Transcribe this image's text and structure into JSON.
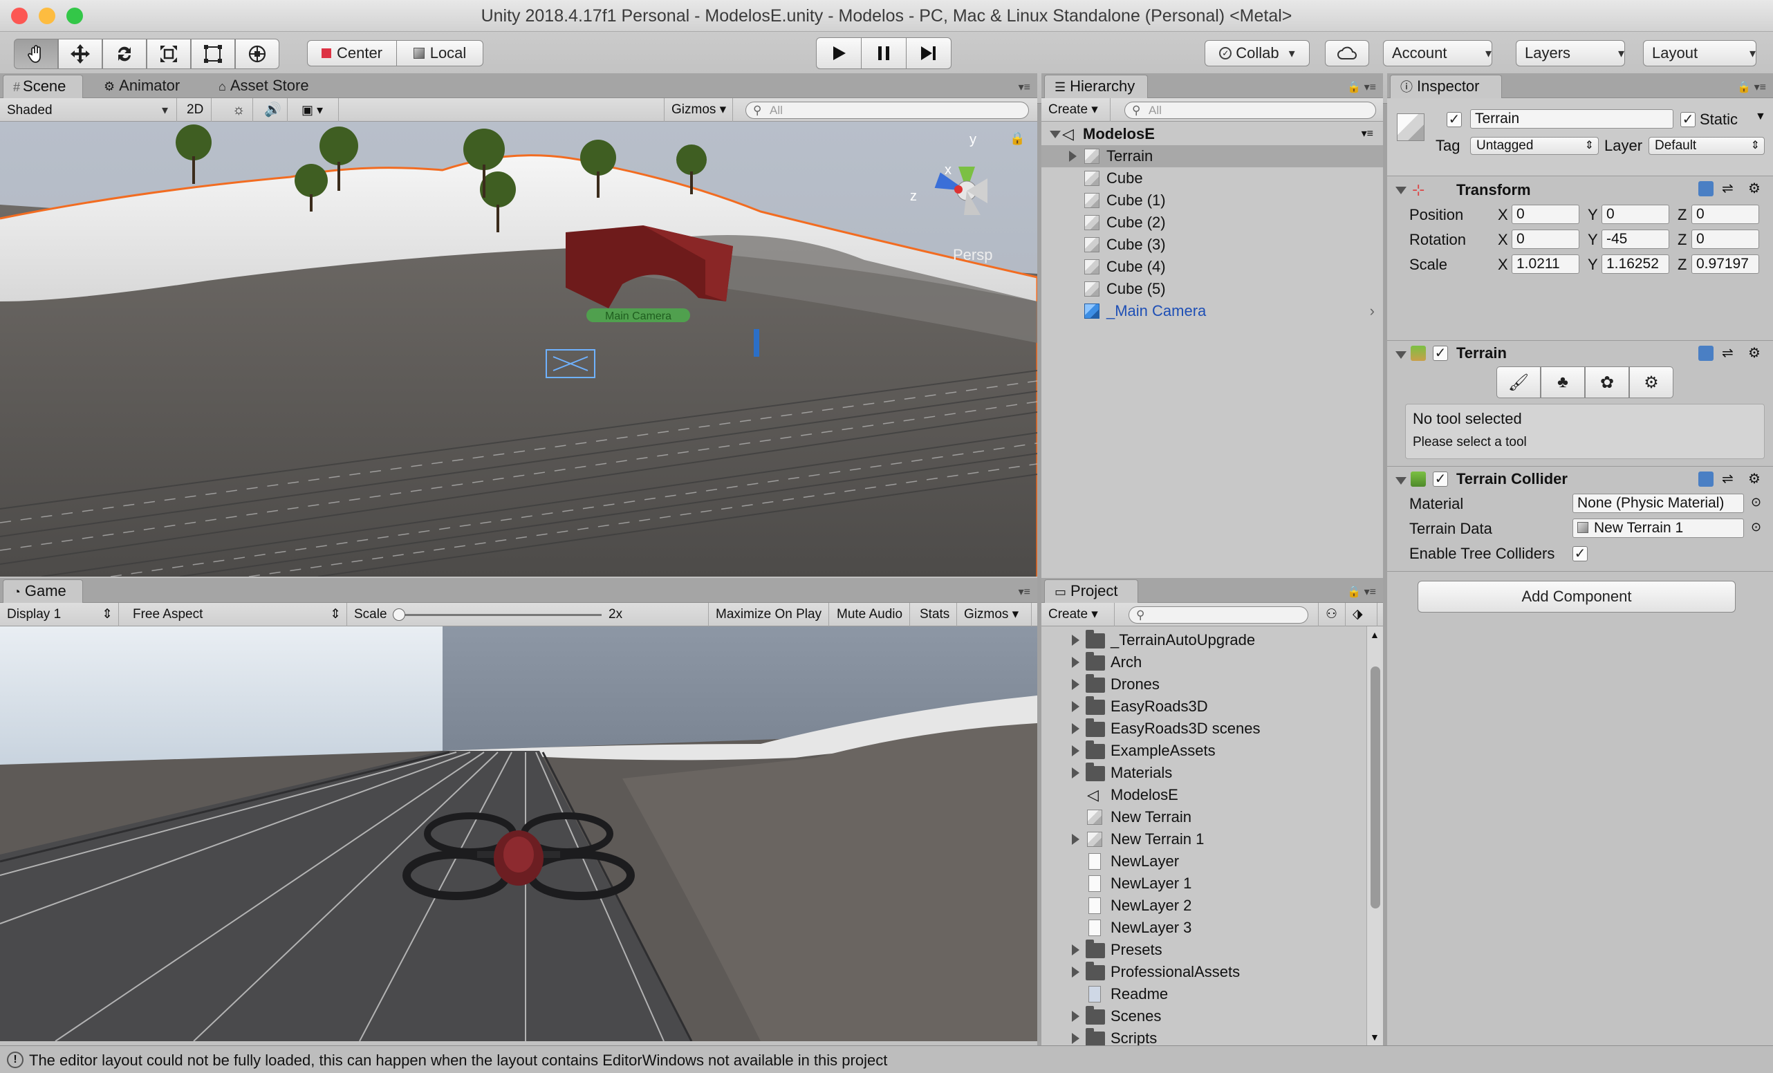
{
  "window": {
    "title": "Unity 2018.4.17f1 Personal - ModelosE.unity - Modelos - PC, Mac & Linux Standalone (Personal) <Metal>"
  },
  "colors": {
    "close": "#fc5753",
    "minimize": "#fdbc40",
    "maximize": "#33c748",
    "selection_orange": "#f26c21",
    "link_blue": "#1e4fb5"
  },
  "toolbar": {
    "tools": [
      "hand-tool",
      "move-tool",
      "rotate-tool",
      "scale-tool",
      "rect-tool",
      "transform-tool"
    ],
    "pivot_center": "Center",
    "pivot_local": "Local",
    "play_controls": [
      "play",
      "pause",
      "step"
    ],
    "collab": "Collab",
    "account": "Account",
    "layers": "Layers",
    "layout": "Layout"
  },
  "scene": {
    "tabs": [
      "Scene",
      "Animator",
      "Asset Store"
    ],
    "shading_mode": "Shaded",
    "mode_2d": "2D",
    "gizmos": "Gizmos",
    "search_placeholder": "All",
    "persp_label": "Persp",
    "camera_label": "Main Camera",
    "axes": {
      "y": "y",
      "x": "x",
      "z": "z"
    }
  },
  "game": {
    "tab": "Game",
    "display": "Display 1",
    "aspect": "Free Aspect",
    "scale_label": "Scale",
    "scale_value": "2x",
    "scale_fraction": 0.0,
    "maximize": "Maximize On Play",
    "mute": "Mute Audio",
    "stats": "Stats",
    "gizmos": "Gizmos"
  },
  "hierarchy": {
    "tab": "Hierarchy",
    "create": "Create",
    "search_placeholder": "All",
    "scene_name": "ModelosE",
    "items": [
      {
        "label": "Terrain",
        "selected": true,
        "has_children": true
      },
      {
        "label": "Cube"
      },
      {
        "label": "Cube (1)"
      },
      {
        "label": "Cube (2)"
      },
      {
        "label": "Cube (3)"
      },
      {
        "label": "Cube (4)"
      },
      {
        "label": "Cube (5)"
      },
      {
        "label": "_Main Camera",
        "prefab": true
      }
    ]
  },
  "project": {
    "tab": "Project",
    "create": "Create",
    "items": [
      {
        "label": "_TerrainAutoUpgrade",
        "type": "folder",
        "expandable": true
      },
      {
        "label": "Arch",
        "type": "folder",
        "expandable": true
      },
      {
        "label": "Drones",
        "type": "folder",
        "expandable": true
      },
      {
        "label": "EasyRoads3D",
        "type": "folder",
        "expandable": true
      },
      {
        "label": "EasyRoads3D scenes",
        "type": "folder",
        "expandable": true
      },
      {
        "label": "ExampleAssets",
        "type": "folder",
        "expandable": true
      },
      {
        "label": "Materials",
        "type": "folder",
        "expandable": true
      },
      {
        "label": "ModelosE",
        "type": "scene",
        "expandable": false
      },
      {
        "label": "New Terrain",
        "type": "terrain",
        "expandable": false
      },
      {
        "label": "New Terrain 1",
        "type": "terrain",
        "expandable": true
      },
      {
        "label": "NewLayer",
        "type": "file",
        "expandable": false
      },
      {
        "label": "NewLayer 1",
        "type": "file",
        "expandable": false
      },
      {
        "label": "NewLayer 2",
        "type": "file",
        "expandable": false
      },
      {
        "label": "NewLayer 3",
        "type": "file",
        "expandable": false
      },
      {
        "label": "Presets",
        "type": "folder",
        "expandable": true
      },
      {
        "label": "ProfessionalAssets",
        "type": "folder",
        "expandable": true
      },
      {
        "label": "Readme",
        "type": "readme",
        "expandable": false
      },
      {
        "label": "Scenes",
        "type": "folder",
        "expandable": true
      },
      {
        "label": "Scripts",
        "type": "folder",
        "expandable": true
      }
    ]
  },
  "inspector": {
    "tab": "Inspector",
    "object_name": "Terrain",
    "static_label": "Static",
    "tag_label": "Tag",
    "tag_value": "Untagged",
    "layer_label": "Layer",
    "layer_value": "Default",
    "transform": {
      "title": "Transform",
      "rows": [
        {
          "label": "Position",
          "x": "0",
          "y": "0",
          "z": "0"
        },
        {
          "label": "Rotation",
          "x": "0",
          "y": "-45",
          "z": "0"
        },
        {
          "label": "Scale",
          "x": "1.0211",
          "y": "1.16252",
          "z": "0.97197"
        }
      ],
      "axis_x": "X",
      "axis_y": "Y",
      "axis_z": "Z"
    },
    "terrain": {
      "title": "Terrain",
      "tools": [
        "paint-brush-icon",
        "tree-icon",
        "details-icon",
        "settings-gear-icon"
      ],
      "message_title": "No tool selected",
      "message_body": "Please select a tool"
    },
    "collider": {
      "title": "Terrain Collider",
      "material_label": "Material",
      "material_value": "None (Physic Material)",
      "data_label": "Terrain Data",
      "data_value": "New Terrain 1",
      "trees_label": "Enable Tree Colliders"
    },
    "add_component": "Add Component"
  },
  "status": {
    "message": "The editor layout could not be fully loaded, this can happen when the layout contains EditorWindows not available in this project"
  }
}
